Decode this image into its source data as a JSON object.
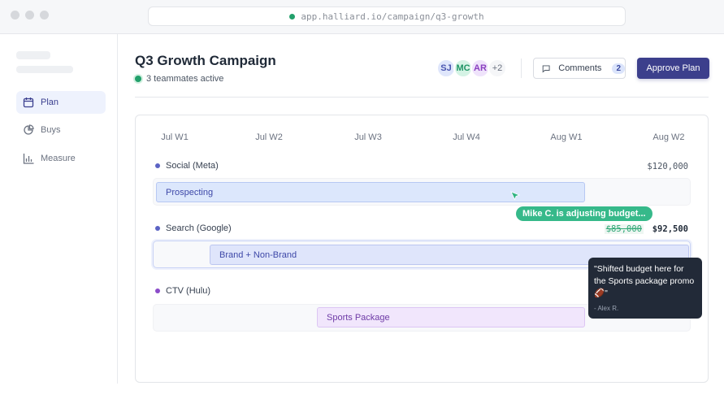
{
  "browser": {
    "url": "app.halliard.io/campaign/q3-growth"
  },
  "sidebar": {
    "items": [
      {
        "label": "Plan",
        "icon": "calendar-icon",
        "active": true
      },
      {
        "label": "Buys",
        "icon": "pie-chart-icon"
      },
      {
        "label": "Measure",
        "icon": "bar-chart-icon"
      }
    ]
  },
  "header": {
    "title": "Q3 Growth Campaign",
    "presence": "3 teammates active",
    "avatars": [
      {
        "initials": "SJ",
        "bg": "#dfe6fb",
        "fg": "#4a55b0"
      },
      {
        "initials": "MC",
        "bg": "#d5f3e5",
        "fg": "#1f9465"
      },
      {
        "initials": "AR",
        "bg": "#efe3fb",
        "fg": "#8a3fc0"
      }
    ],
    "more": "+2",
    "comments_label": "Comments",
    "comments_count": "2",
    "approve_label": "Approve Plan"
  },
  "timeline": {
    "weeks": [
      "Jul W1",
      "Jul W2",
      "Jul W3",
      "Jul W4",
      "Aug W1",
      "Aug W2"
    ],
    "channels": [
      {
        "name": "Social (Meta)",
        "amount": "$120,000",
        "bar": "Prospecting",
        "dot": "#5b63c4"
      },
      {
        "name": "Search (Google)",
        "old_amount": "$85,000",
        "amount": "$92,500",
        "bar": "Brand + Non-Brand",
        "dot": "#5b63c4"
      },
      {
        "name": "CTV (Hulu)",
        "bar": "Sports Package",
        "dot": "#8b4cc9"
      }
    ]
  },
  "presence_tag": "Mike C. is adjusting budget...",
  "comment": {
    "text": "\"Shifted budget here for the Sports package promo 🏈\"",
    "author": "- Alex R."
  }
}
